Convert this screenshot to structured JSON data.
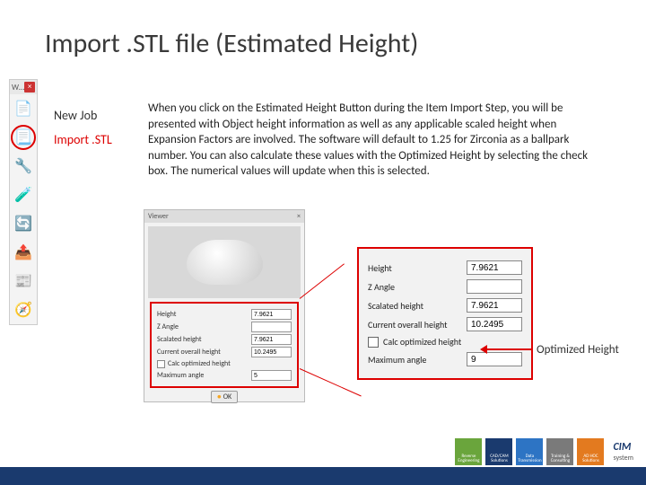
{
  "title": "Import .STL file (Estimated Height)",
  "toolbar": {
    "header": "W…",
    "close": "×",
    "icons": [
      {
        "name": "new-job-icon",
        "glyph": "📄",
        "circled": false
      },
      {
        "name": "import-stl-icon",
        "glyph": "📃",
        "circled": true
      },
      {
        "name": "heal-mesh-icon",
        "glyph": "🔧",
        "circled": false
      },
      {
        "name": "measure-icon",
        "glyph": "🧪",
        "circled": false
      },
      {
        "name": "orient-icon",
        "glyph": "🔄",
        "circled": false
      },
      {
        "name": "export-icon",
        "glyph": "📤",
        "circled": false
      },
      {
        "name": "report-icon",
        "glyph": "📰",
        "circled": false
      },
      {
        "name": "simulate-icon",
        "glyph": "🧭",
        "circled": false
      }
    ]
  },
  "steps": {
    "new_job": "New Job",
    "import_stl": "Import .STL"
  },
  "body_text": "When you click on the Estimated Height Button during the Item Import Step, you will be presented with Object height information as well as any applicable scaled height when Expansion Factors are involved. The software will default to 1.25 for Zirconia as a ballpark number. You can also calculate these values with the Optimized Height by selecting the check box. The numerical values will update when this is selected.",
  "viewer": {
    "title": "Viewer",
    "close": "×",
    "fields": {
      "height_label": "Height",
      "height_value": "7.9621",
      "z_label": "Z Angle",
      "z_value": "",
      "scaled_label": "Scalated height",
      "scaled_value": "7.9621",
      "overall_label": "Current overall height",
      "overall_value": "10.2495",
      "opt_label": "Calc optimized height",
      "max_label": "Maximum angle",
      "max_value": "5"
    },
    "ok_label": "OK"
  },
  "zoom_panel": {
    "height_label": "Height",
    "height_value": "7.9621",
    "z_label": "Z Angle",
    "z_value": "",
    "scaled_label": "Scalated height",
    "scaled_value": "7.9621",
    "overall_label": "Current overall height",
    "overall_value": "10.2495",
    "opt_label": "Calc optimized height",
    "max_label": "Maximum angle",
    "max_value": "9"
  },
  "callout": "Optimized Height",
  "footer": {
    "logos": [
      "Reverse Engineering",
      "CAD/CAM Solutions",
      "Data Transmission",
      "Training & Consulting",
      "AD HOC Solutions"
    ],
    "brand": "CIM",
    "brand_sub": "system"
  }
}
